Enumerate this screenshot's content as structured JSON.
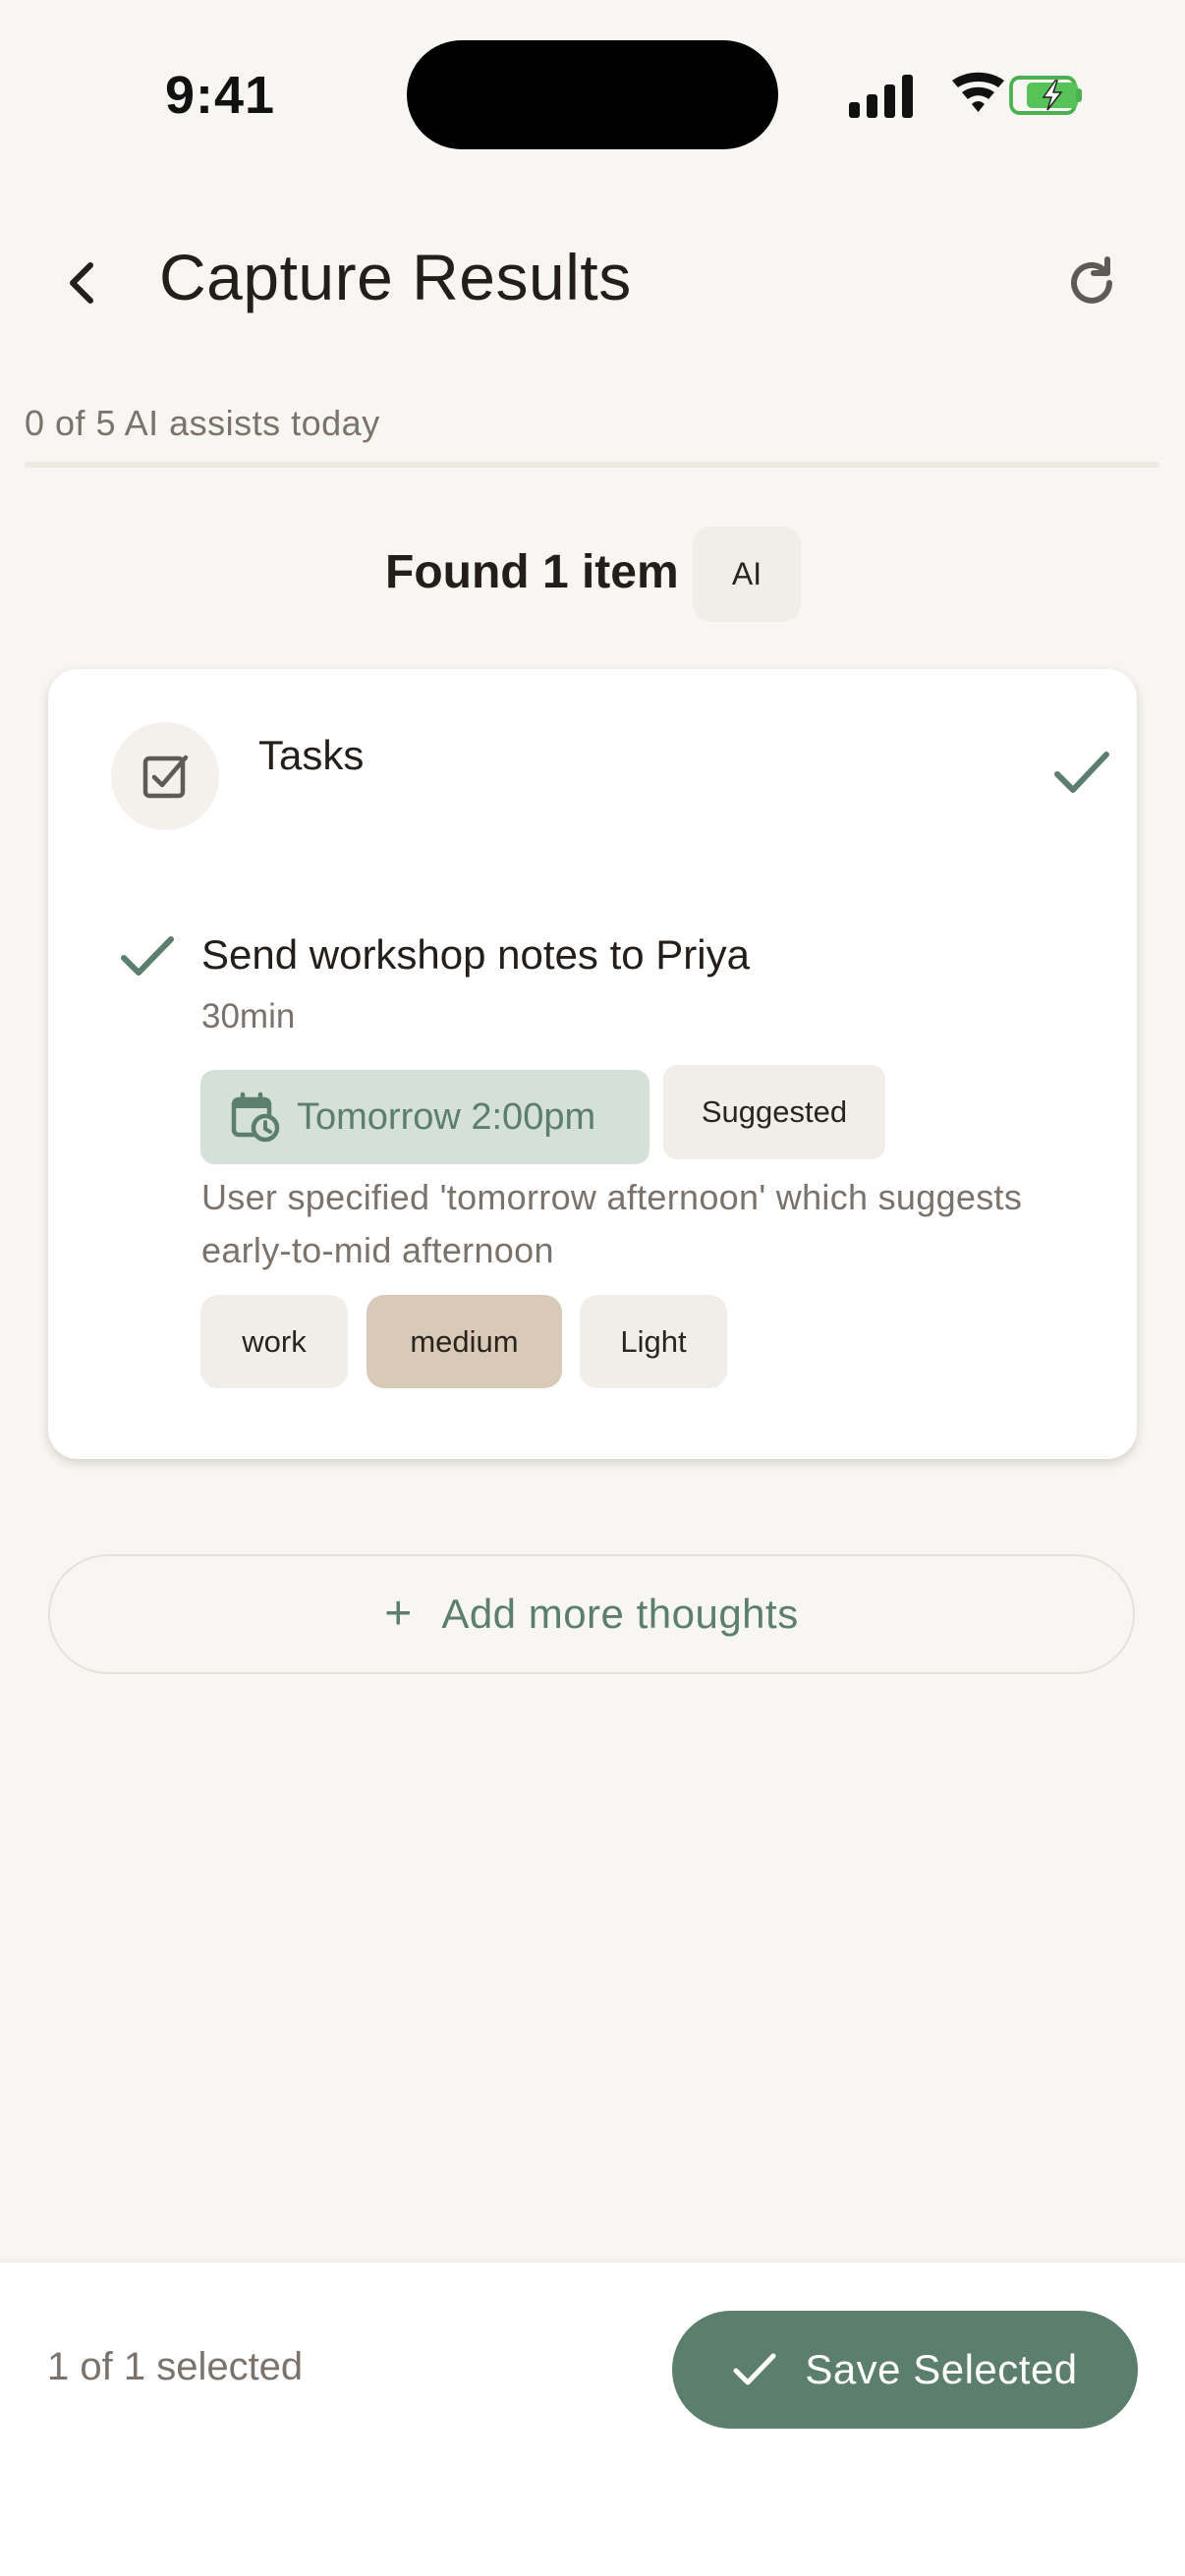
{
  "status_bar": {
    "time": "9:41",
    "icons": [
      "cellular-signal-icon",
      "wifi-icon",
      "battery-charging-icon"
    ]
  },
  "header": {
    "title": "Capture Results",
    "back_icon": "chevron-left-icon",
    "refresh_icon": "refresh-icon"
  },
  "usage": {
    "text": "0 of 5 AI assists today",
    "used": 0,
    "limit": 5
  },
  "found": {
    "text": "Found 1 item",
    "badge": "AI"
  },
  "card": {
    "category_icon": "checkbox-icon",
    "category_label": "Tasks",
    "selected": true,
    "item": {
      "title": "Send workshop notes to Priya",
      "duration": "30min",
      "schedule": {
        "icon": "calendar-clock-icon",
        "label": "Tomorrow 2:00pm",
        "badge": "Suggested"
      },
      "reason": "User specified 'tomorrow afternoon' which suggests early-to-mid afternoon",
      "tags": [
        "work",
        "medium",
        "Light"
      ]
    }
  },
  "add_more": {
    "icon": "plus-icon",
    "label": "Add more thoughts"
  },
  "footer": {
    "selected_text": "1 of 1 selected",
    "save_label": "Save Selected",
    "save_icon": "check-icon"
  },
  "colors": {
    "accent": "#5C7E6C",
    "background": "#F8F6F2",
    "chip_bg": "#F1EEE9",
    "tag_medium": "#D8CAB7",
    "date_chip": "#D5E0D9"
  }
}
